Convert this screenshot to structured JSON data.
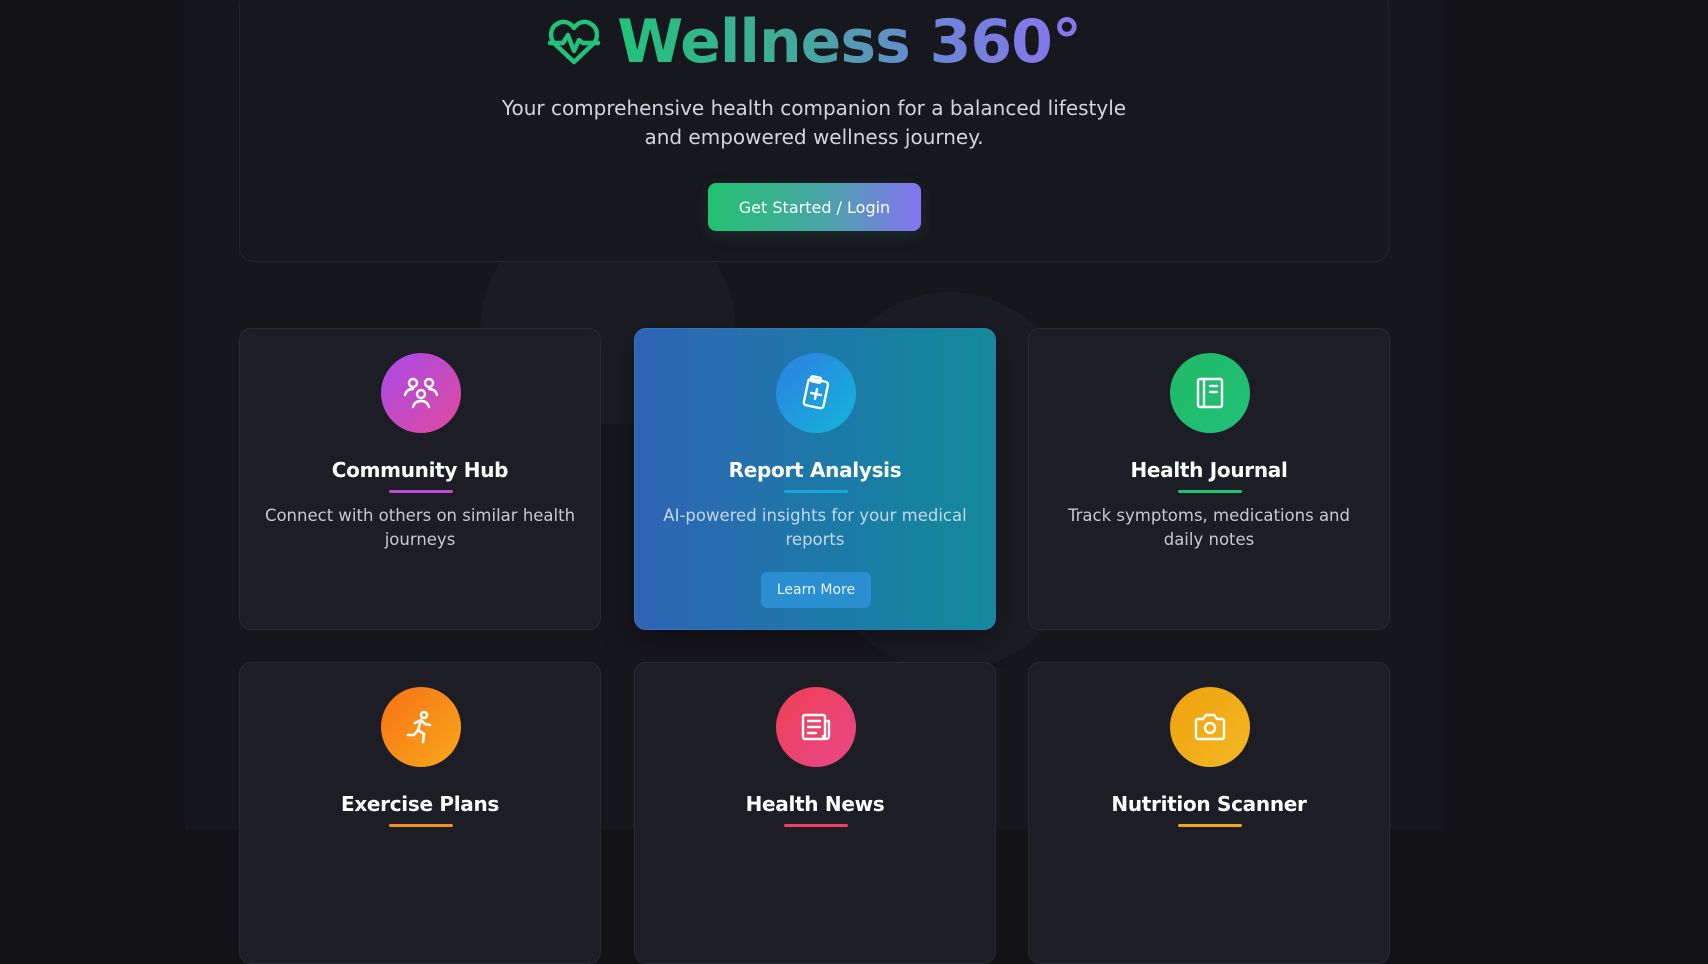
{
  "hero": {
    "brand_word": "Wellness",
    "brand_suffix": "360°",
    "subtitle_line1": "Your comprehensive health companion for a balanced lifestyle",
    "subtitle_line2": "and empowered wellness journey.",
    "cta_label": "Get Started / Login",
    "logo_icon": "heart-pulse-icon"
  },
  "colors": {
    "background": "#121217",
    "brand_green": "#22c27a",
    "brand_purple": "#8b74ee"
  },
  "cards": [
    {
      "title": "Community Hub",
      "description": "Connect with others on similar health journeys",
      "icon": "users-icon",
      "accent": "#c04bd8"
    },
    {
      "title": "Report Analysis",
      "description": "AI-powered insights for your medical reports",
      "icon": "clipboard-plus-icon",
      "accent": "#1aa6d6",
      "button_label": "Learn More"
    },
    {
      "title": "Health Journal",
      "description": "Track symptoms, medications and daily notes",
      "icon": "journal-icon",
      "accent": "#22c270"
    },
    {
      "title": "Exercise Plans",
      "description": "",
      "icon": "running-icon",
      "accent": "#f7901e"
    },
    {
      "title": "Health News",
      "description": "",
      "icon": "newspaper-icon",
      "accent": "#ec4066"
    },
    {
      "title": "Nutrition Scanner",
      "description": "",
      "icon": "camera-icon",
      "accent": "#f0a81a"
    }
  ]
}
